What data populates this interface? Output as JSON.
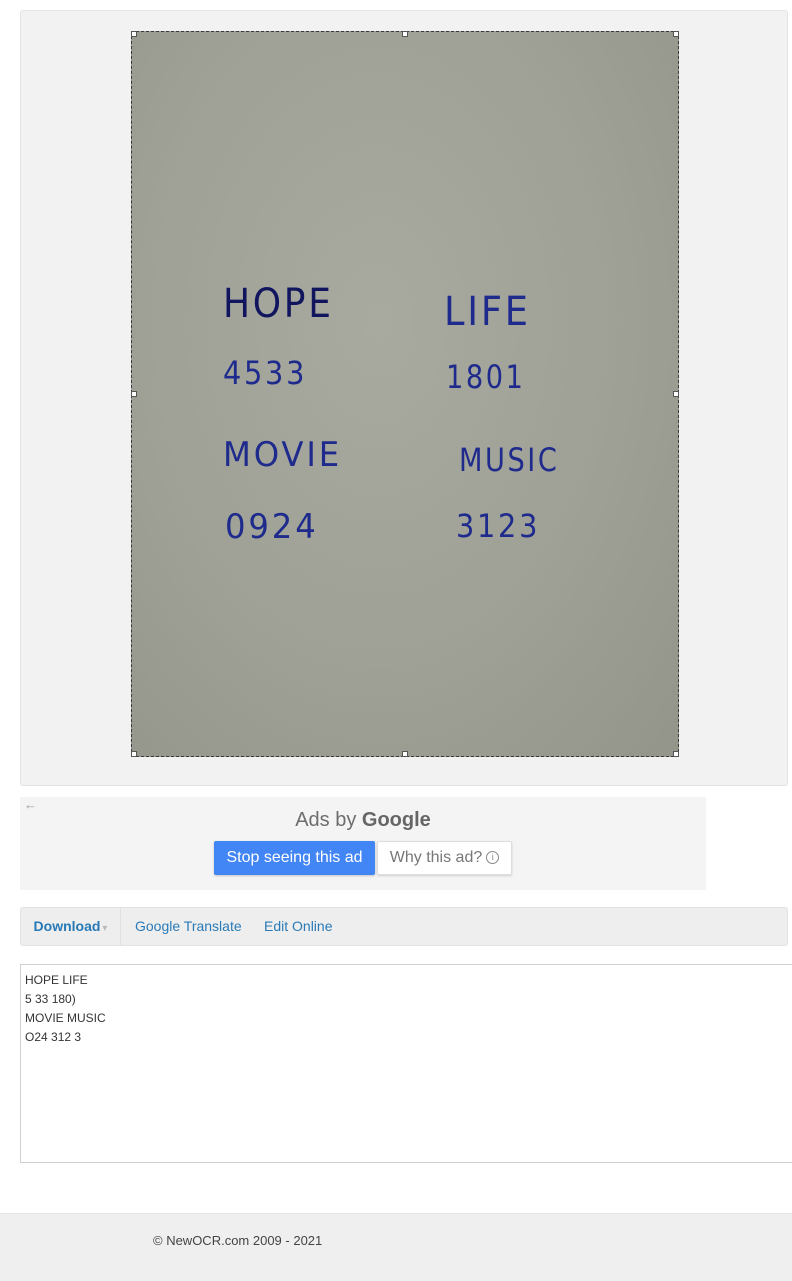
{
  "preview": {
    "handwriting": {
      "line1_left": "HOPE",
      "line1_right": "LIFE",
      "line2_left": "4533",
      "line2_right": "1801",
      "line3_left": "MOVIE",
      "line3_right": "MUSIC",
      "line4_left": "0924",
      "line4_right": "3123"
    }
  },
  "ad": {
    "back_symbol": "←",
    "ads_by": "Ads by",
    "brand": "Google",
    "stop_label": "Stop seeing this ad",
    "why_label": "Why this ad?",
    "info_symbol": "i"
  },
  "toolbar": {
    "download_label": "Download",
    "translate_label": "Google Translate",
    "edit_label": "Edit Online"
  },
  "ocr_result": "HOPE LIFE\n5 33 180)\nMOVIE MUSIC\nO24 312 3",
  "footer": {
    "copyright": "© NewOCR.com 2009 - 2021"
  },
  "colors": {
    "ink": "#1e2a8c",
    "paper": "#9fa197",
    "ad_button": "#4285f4",
    "link": "#2a7ab8"
  }
}
